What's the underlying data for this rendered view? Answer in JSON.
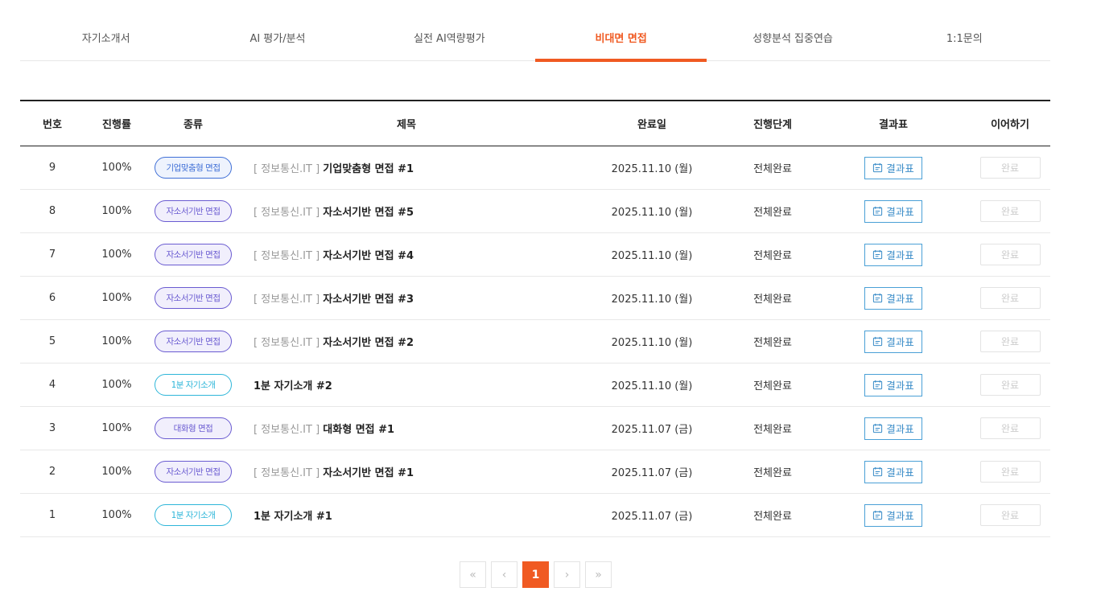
{
  "tabs": [
    {
      "label": "자기소개서",
      "active": false
    },
    {
      "label": "AI 평가/분석",
      "active": false
    },
    {
      "label": "실전 AI역량평가",
      "active": false
    },
    {
      "label": "비대면 면접",
      "active": true
    },
    {
      "label": "성향분석 집중연습",
      "active": false
    },
    {
      "label": "1:1문의",
      "active": false
    }
  ],
  "table": {
    "headers": {
      "num": "번호",
      "progress": "진행률",
      "type": "종류",
      "title": "제목",
      "date": "완료일",
      "stage": "진행단계",
      "result": "결과표",
      "continue": "이어하기"
    },
    "rows": [
      {
        "num": "9",
        "progress": "100%",
        "type": "기업맞춤형 면접",
        "type_style": "corp",
        "prefix": "[ 정보통신.IT ]",
        "title": "기업맞춤형 면접 #1",
        "date": "2025.11.10 (월)",
        "stage": "전체완료",
        "result": "결과표",
        "continue": "완료"
      },
      {
        "num": "8",
        "progress": "100%",
        "type": "자소서기반 면접",
        "type_style": "resume",
        "prefix": "[ 정보통신.IT ]",
        "title": "자소서기반 면접 #5",
        "date": "2025.11.10 (월)",
        "stage": "전체완료",
        "result": "결과표",
        "continue": "완료"
      },
      {
        "num": "7",
        "progress": "100%",
        "type": "자소서기반 면접",
        "type_style": "resume",
        "prefix": "[ 정보통신.IT ]",
        "title": "자소서기반 면접 #4",
        "date": "2025.11.10 (월)",
        "stage": "전체완료",
        "result": "결과표",
        "continue": "완료"
      },
      {
        "num": "6",
        "progress": "100%",
        "type": "자소서기반 면접",
        "type_style": "resume",
        "prefix": "[ 정보통신.IT ]",
        "title": "자소서기반 면접 #3",
        "date": "2025.11.10 (월)",
        "stage": "전체완료",
        "result": "결과표",
        "continue": "완료"
      },
      {
        "num": "5",
        "progress": "100%",
        "type": "자소서기반 면접",
        "type_style": "resume",
        "prefix": "[ 정보통신.IT ]",
        "title": "자소서기반 면접 #2",
        "date": "2025.11.10 (월)",
        "stage": "전체완료",
        "result": "결과표",
        "continue": "완료"
      },
      {
        "num": "4",
        "progress": "100%",
        "type": "1분 자기소개",
        "type_style": "intro",
        "prefix": "",
        "title": "1분 자기소개 #2",
        "date": "2025.11.10 (월)",
        "stage": "전체완료",
        "result": "결과표",
        "continue": "완료"
      },
      {
        "num": "3",
        "progress": "100%",
        "type": "대화형 면접",
        "type_style": "chat",
        "prefix": "[ 정보통신.IT ]",
        "title": "대화형 면접 #1",
        "date": "2025.11.07 (금)",
        "stage": "전체완료",
        "result": "결과표",
        "continue": "완료"
      },
      {
        "num": "2",
        "progress": "100%",
        "type": "자소서기반 면접",
        "type_style": "resume",
        "prefix": "[ 정보통신.IT ]",
        "title": "자소서기반 면접 #1",
        "date": "2025.11.07 (금)",
        "stage": "전체완료",
        "result": "결과표",
        "continue": "완료"
      },
      {
        "num": "1",
        "progress": "100%",
        "type": "1분 자기소개",
        "type_style": "intro",
        "prefix": "",
        "title": "1분 자기소개 #1",
        "date": "2025.11.07 (금)",
        "stage": "전체완료",
        "result": "결과표",
        "continue": "완료"
      }
    ]
  },
  "pagination": {
    "first": "«",
    "prev": "‹",
    "pages": [
      "1"
    ],
    "current": "1",
    "next": "›",
    "last": "»"
  },
  "colors": {
    "accent": "#f05a22",
    "result_button": "#3a8cc8"
  }
}
